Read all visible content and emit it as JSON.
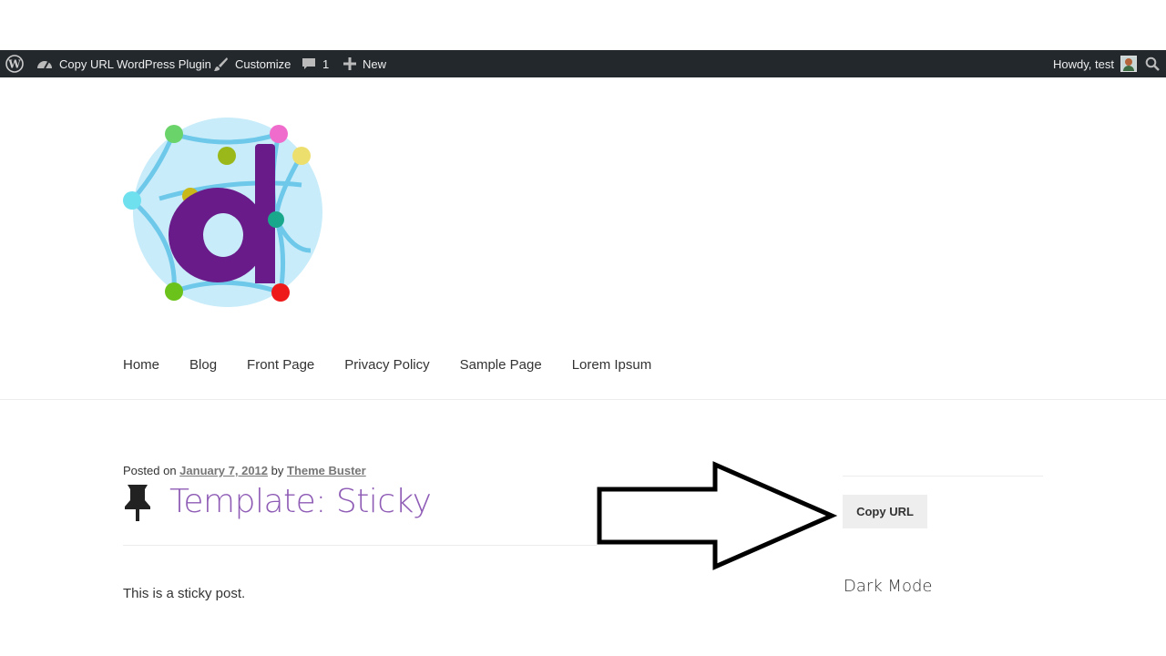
{
  "admin_bar": {
    "site_name": "Copy URL WordPress Plugin",
    "customize_label": "Customize",
    "comments_count": "1",
    "new_label": "New",
    "greeting": "Howdy, test"
  },
  "nav": {
    "items": [
      "Home",
      "Blog",
      "Front Page",
      "Privacy Policy",
      "Sample Page",
      "Lorem Ipsum"
    ]
  },
  "post": {
    "posted_on_label": "Posted on",
    "date": "January 7, 2012",
    "by_label": "by",
    "author": "Theme Buster",
    "title": "Template: Sticky",
    "content": "This is a sticky post."
  },
  "sidebar": {
    "copy_button_label": "Copy URL",
    "heading": "Dark Mode"
  },
  "colors": {
    "admin_bar_bg": "#23282d",
    "title_accent": "#8e5bb5",
    "logo_letter": "#6a1b8a"
  }
}
